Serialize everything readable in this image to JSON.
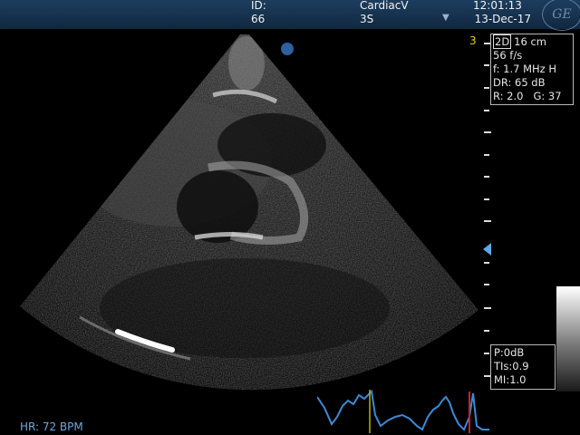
{
  "header": {
    "id_label": "ID:",
    "id_value": "66",
    "app": "CardiacV",
    "probe": "3S",
    "time": "12:01:13",
    "date": "13-Dec-17",
    "logo": "GE"
  },
  "zone_number": "3",
  "params": {
    "mode": "2D",
    "depth": "16 cm",
    "frame_rate": "56 f/s",
    "frequency": "f: 1.7 MHz H",
    "dynamic_range": "DR: 65 dB",
    "reject": "R: 2.0",
    "gain": "G: 37"
  },
  "indices": {
    "power": "P:0dB",
    "tis": "TIs:0.9",
    "mi": "MI:1.0"
  },
  "heart_rate": "HR: 72 BPM",
  "colors": {
    "header_bg": "#1d3d5e",
    "ecg_trace": "#3a8ad8",
    "focus_marker": "#5ea8e6",
    "zone_number": "#e8d200"
  },
  "icons": {
    "probe_select": "triangle-down-icon",
    "orientation": "orientation-dot-icon",
    "focus": "focus-marker-icon"
  }
}
